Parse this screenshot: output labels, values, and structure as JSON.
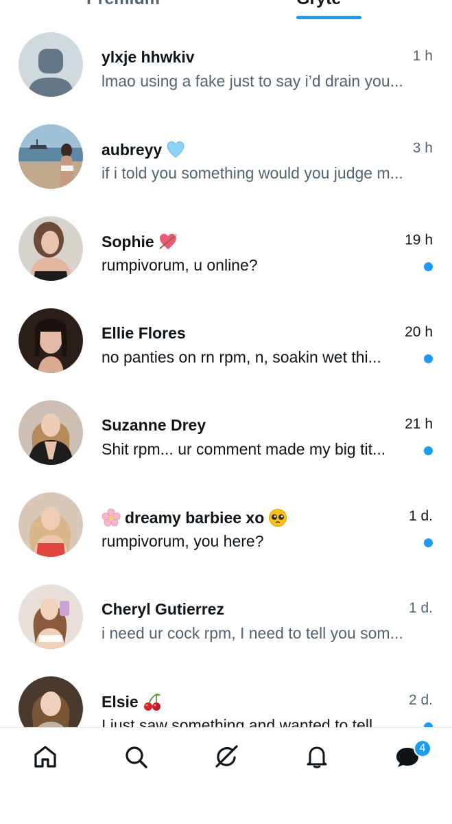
{
  "tabs": {
    "left": "Premium",
    "right": "Gryte"
  },
  "conversations": [
    {
      "name": "ylxje hhwkiv",
      "time": "1 h",
      "preview": "lmao using a fake just to say i’d drain you...",
      "unread": false,
      "name_emoji": ""
    },
    {
      "name": "aubreyy",
      "time": "3 h",
      "preview": "if i told you something would you judge m...",
      "unread": false,
      "name_emoji": "blue-heart-icon"
    },
    {
      "name": "Sophie",
      "time": "19 h",
      "preview": "rumpivorum, u online?",
      "unread": true,
      "name_emoji": "heart-with-arrow-icon"
    },
    {
      "name": "Ellie Flores",
      "time": "20 h",
      "preview": "no panties on rn rpm,  n,  soakin wet thi...",
      "unread": true,
      "name_emoji": ""
    },
    {
      "name": "Suzanne Drey",
      "time": "21 h",
      "preview": "Shit rpm... ur comment made my big tit...",
      "unread": true,
      "name_emoji": ""
    },
    {
      "name": "dreamy barbiee xo",
      "time": "1 d.",
      "preview": "rumpivorum, you here?",
      "unread": true,
      "name_emoji": "pleading-face-icon",
      "prefix_emoji": "cherry-blossom-icon"
    },
    {
      "name": "Cheryl Gutierrez",
      "time": "1 d.",
      "preview": "i need ur cock rpm, I need to tell you som...",
      "unread": false,
      "name_emoji": ""
    },
    {
      "name": "Elsie",
      "time": "2 d.",
      "preview": "I just saw something and wanted to tell...",
      "unread": true,
      "name_emoji": "cherries-icon"
    }
  ],
  "bottom_nav": {
    "items": [
      "home-icon",
      "search-icon",
      "grok-icon",
      "notifications-icon",
      "messages-icon"
    ],
    "messages_badge": "4"
  },
  "colors": {
    "accent": "#1d9bf0",
    "text": "#0f1419",
    "muted": "#536471"
  }
}
